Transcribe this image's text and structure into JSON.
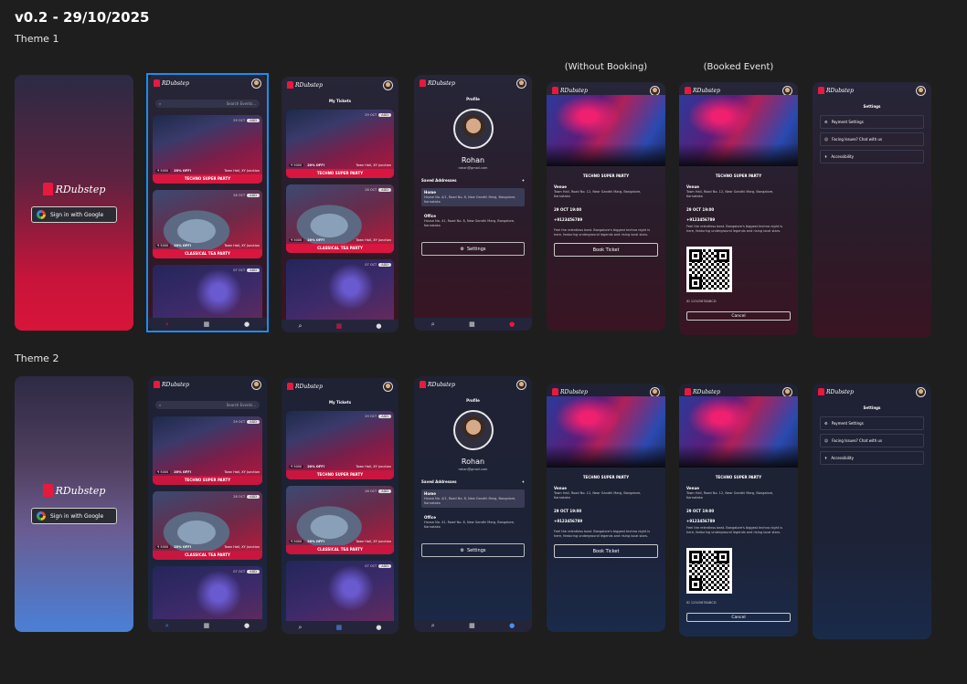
{
  "title": "v0.2 - 29/10/2025",
  "themes": [
    {
      "label": "Theme 1"
    },
    {
      "label": "Theme 2"
    }
  ],
  "headers": {
    "without": "(Without Booking)",
    "booked": "(Booked Event)"
  },
  "brand": "RDubstep",
  "google_btn": "Sign in with Google",
  "search_placeholder": "Search Events...",
  "my_tickets": "My Tickets",
  "events": [
    {
      "name": "TECHNO SUPER PARTY",
      "price": "₹ 5000",
      "off": "20% OFF!",
      "venue": "Town Hall, XY Junction",
      "date": "29 OCT",
      "badge": "ADD"
    },
    {
      "name": "CLASSICAL TEA PARTY",
      "price": "₹ 5000",
      "off": "20% OFF!",
      "venue": "Town Hall, XY Junction",
      "date": "28 OCT",
      "badge": "ADD"
    },
    {
      "name": "",
      "price": "",
      "off": "",
      "venue": "",
      "date": "07 OCT",
      "badge": "ADD"
    }
  ],
  "profile": {
    "section": "Profile",
    "name": "Rohan",
    "email": "rohan@gmail.com",
    "saved": "Saved Addresses",
    "add": "+",
    "home_label": "Home",
    "home": "House No. 4/1, Road No. 8, New Gandhi Marg, Bangalore, Karnataka",
    "office_label": "Office",
    "office": "House No. 41, Road No. 8, New Gandhi Marg, Bangalore, Karnataka",
    "settings": "Settings"
  },
  "event": {
    "title": "TECHNO SUPER PARTY",
    "venue_label": "Venue",
    "venue": "Town Hall, Road No. 12, Near Gandhi Marg, Bangalore, Karnataka",
    "date": "29 OCT 19:00",
    "phone": "+9123456789",
    "desc": "Feel the relentless beat. Bangalore's biggest techno night is here, featuring underground legends and rising local stars.",
    "book": "Book Ticket",
    "booking_id": "ID 12345678ABCD",
    "cancel": "Cancel"
  },
  "settings": {
    "section": "Settings",
    "items": [
      {
        "label": "Payment Settings",
        "icon": "⚙"
      },
      {
        "label": "Facing Issues? Chat with us",
        "icon": "☺"
      },
      {
        "label": "Accessibility",
        "icon": "✝"
      }
    ]
  },
  "nav": {
    "search": "⌕",
    "tickets": "▦",
    "profile": "●"
  }
}
